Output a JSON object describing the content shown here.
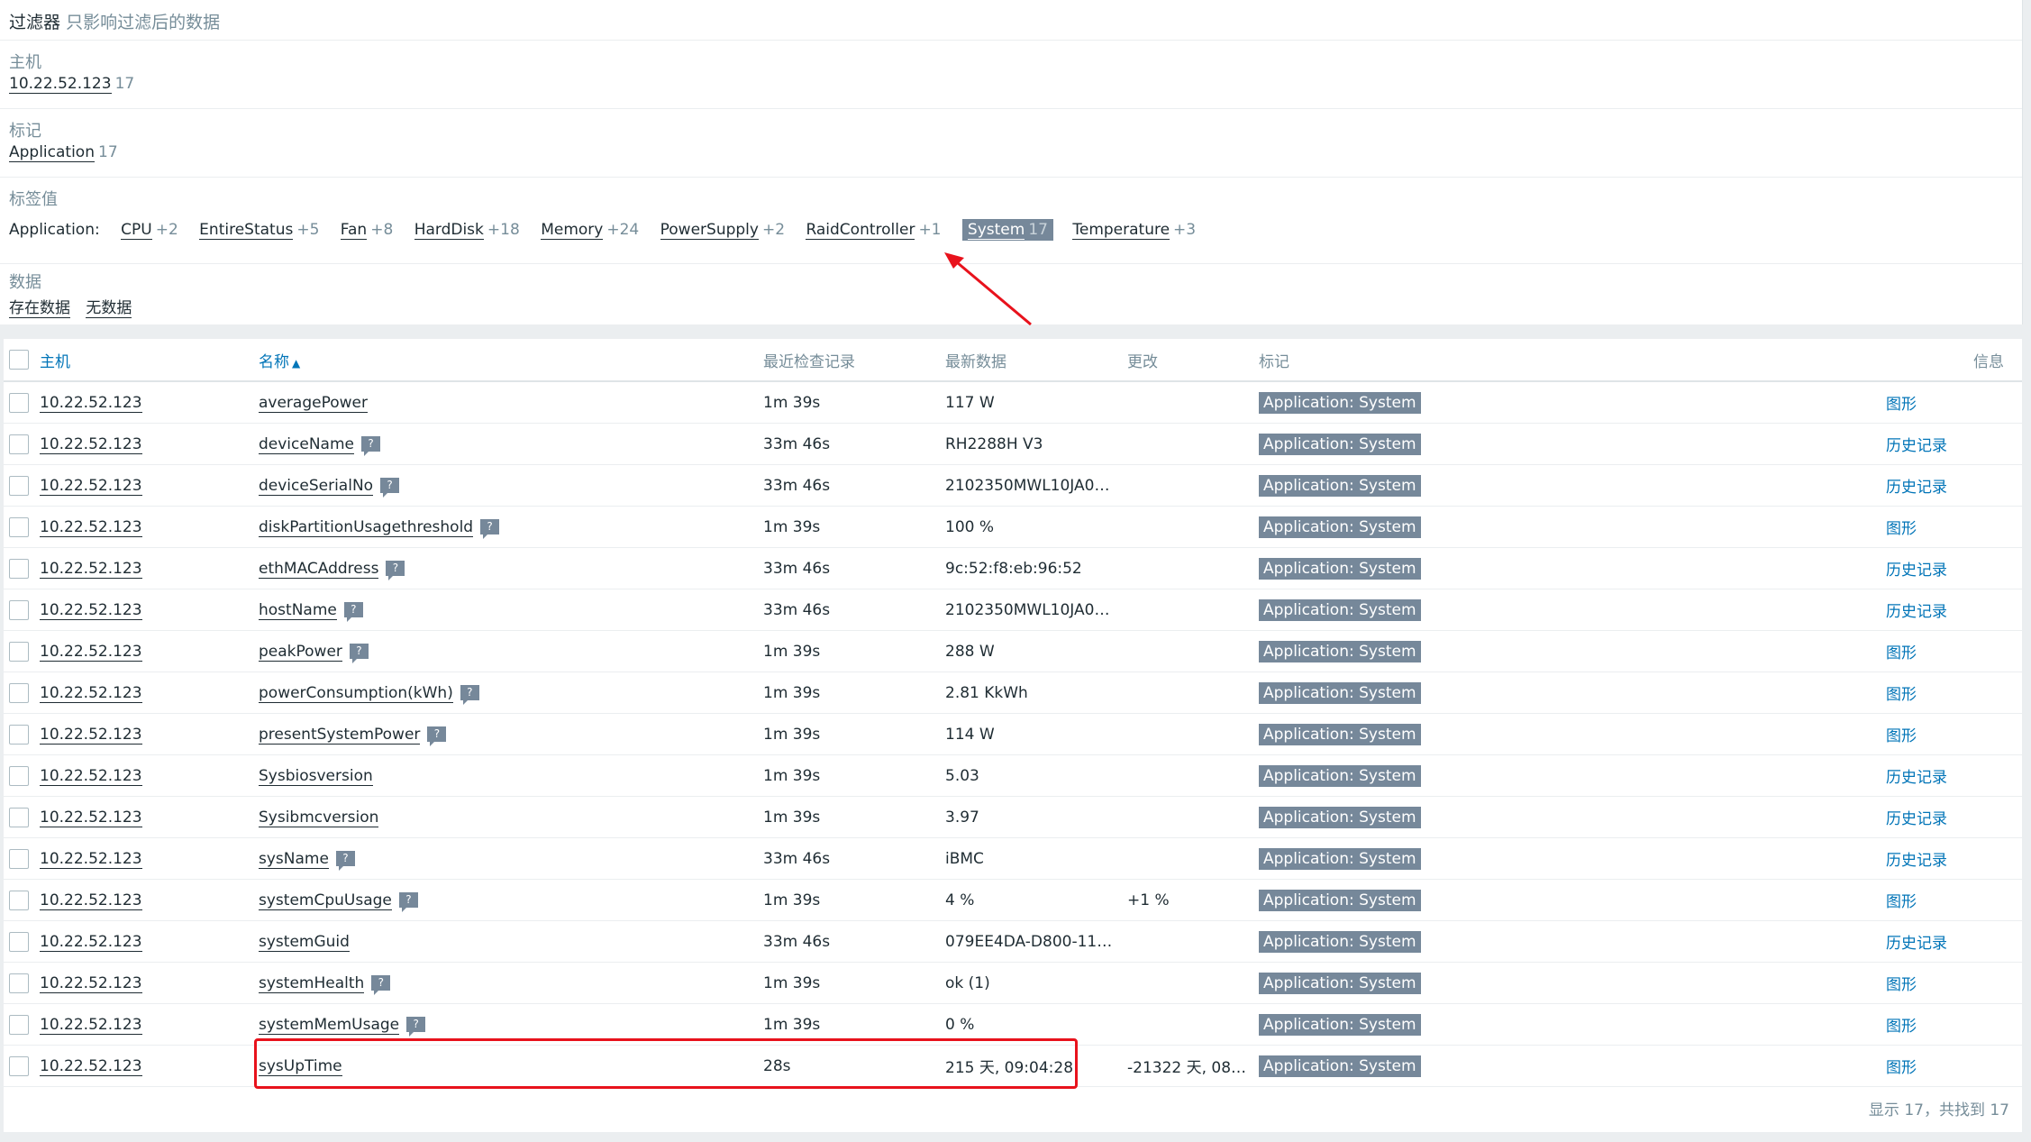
{
  "filter": {
    "title": "过滤器",
    "subtitle": "只影响过滤后的数据",
    "host": {
      "label": "主机",
      "value": "10.22.52.123",
      "count": "17"
    },
    "tag": {
      "label": "标记",
      "value": "Application",
      "count": "17"
    },
    "tagvalues": {
      "label": "标签值",
      "prefix": "Application:",
      "items": [
        {
          "name": "CPU",
          "count": "+2"
        },
        {
          "name": "EntireStatus",
          "count": "+5"
        },
        {
          "name": "Fan",
          "count": "+8"
        },
        {
          "name": "HardDisk",
          "count": "+18"
        },
        {
          "name": "Memory",
          "count": "+24"
        },
        {
          "name": "PowerSupply",
          "count": "+2"
        },
        {
          "name": "RaidController",
          "count": "+1"
        },
        {
          "name": "System",
          "count": "17"
        },
        {
          "name": "Temperature",
          "count": "+3"
        }
      ]
    },
    "data": {
      "label": "数据",
      "with": "存在数据",
      "without": "无数据"
    }
  },
  "table": {
    "headers": {
      "host": "主机",
      "name": "名称",
      "sort_arrow": "▲",
      "lastcheck": "最近检查记录",
      "lastvalue": "最新数据",
      "change": "更改",
      "tags": "标记",
      "info": "信息"
    },
    "rows": [
      {
        "host": "10.22.52.123",
        "name": "averagePower",
        "check": "1m 39s",
        "value": "117 W",
        "change": "",
        "tag": "Application: System",
        "action": "图形"
      },
      {
        "host": "10.22.52.123",
        "name": "deviceName",
        "hint": "?",
        "check": "33m 46s",
        "value": "RH2288H V3",
        "change": "",
        "tag": "Application: System",
        "action": "历史记录"
      },
      {
        "host": "10.22.52.123",
        "name": "deviceSerialNo",
        "hint": "?",
        "check": "33m 46s",
        "value": "2102350MWL10JA0…",
        "change": "",
        "tag": "Application: System",
        "action": "历史记录"
      },
      {
        "host": "10.22.52.123",
        "name": "diskPartitionUsagethreshold",
        "hint": "?",
        "check": "1m 39s",
        "value": "100 %",
        "change": "",
        "tag": "Application: System",
        "action": "图形"
      },
      {
        "host": "10.22.52.123",
        "name": "ethMACAddress",
        "hint": "?",
        "check": "33m 46s",
        "value": "9c:52:f8:eb:96:52",
        "change": "",
        "tag": "Application: System",
        "action": "历史记录"
      },
      {
        "host": "10.22.52.123",
        "name": "hostName",
        "hint": "?",
        "check": "33m 46s",
        "value": "2102350MWL10JA0…",
        "change": "",
        "tag": "Application: System",
        "action": "历史记录"
      },
      {
        "host": "10.22.52.123",
        "name": "peakPower",
        "hint": "?",
        "check": "1m 39s",
        "value": "288 W",
        "change": "",
        "tag": "Application: System",
        "action": "图形"
      },
      {
        "host": "10.22.52.123",
        "name": "powerConsumption(kWh)",
        "hint": "?",
        "check": "1m 39s",
        "value": "2.81 KkWh",
        "change": "",
        "tag": "Application: System",
        "action": "图形"
      },
      {
        "host": "10.22.52.123",
        "name": "presentSystemPower",
        "hint": "?",
        "check": "1m 39s",
        "value": "114 W",
        "change": "",
        "tag": "Application: System",
        "action": "图形"
      },
      {
        "host": "10.22.52.123",
        "name": "Sysbiosversion",
        "check": "1m 39s",
        "value": "5.03",
        "change": "",
        "tag": "Application: System",
        "action": "历史记录"
      },
      {
        "host": "10.22.52.123",
        "name": "Sysibmcversion",
        "check": "1m 39s",
        "value": "3.97",
        "change": "",
        "tag": "Application: System",
        "action": "历史记录"
      },
      {
        "host": "10.22.52.123",
        "name": "sysName",
        "hint": "?",
        "check": "33m 46s",
        "value": "iBMC",
        "change": "",
        "tag": "Application: System",
        "action": "历史记录"
      },
      {
        "host": "10.22.52.123",
        "name": "systemCpuUsage",
        "hint": "?",
        "check": "1m 39s",
        "value": "4 %",
        "change": "+1 %",
        "tag": "Application: System",
        "action": "图形"
      },
      {
        "host": "10.22.52.123",
        "name": "systemGuid",
        "check": "33m 46s",
        "value": "079EE4DA-D800-11…",
        "change": "",
        "tag": "Application: System",
        "action": "历史记录"
      },
      {
        "host": "10.22.52.123",
        "name": "systemHealth",
        "hint": "?",
        "check": "1m 39s",
        "value": "ok (1)",
        "change": "",
        "tag": "Application: System",
        "action": "图形"
      },
      {
        "host": "10.22.52.123",
        "name": "systemMemUsage",
        "hint": "?",
        "check": "1m 39s",
        "value": "0 %",
        "change": "",
        "tag": "Application: System",
        "action": "图形"
      },
      {
        "host": "10.22.52.123",
        "name": "sysUpTime",
        "check": "28s",
        "value": "215 天, 09:04:28",
        "change": "-21322 天, 08…",
        "tag": "Application: System",
        "action": "图形"
      }
    ],
    "footer": "显示 17，共找到 17"
  },
  "colors": {
    "accent": "#0275b8",
    "tag_bg": "#76889a",
    "annotation_red": "#e8121c"
  }
}
